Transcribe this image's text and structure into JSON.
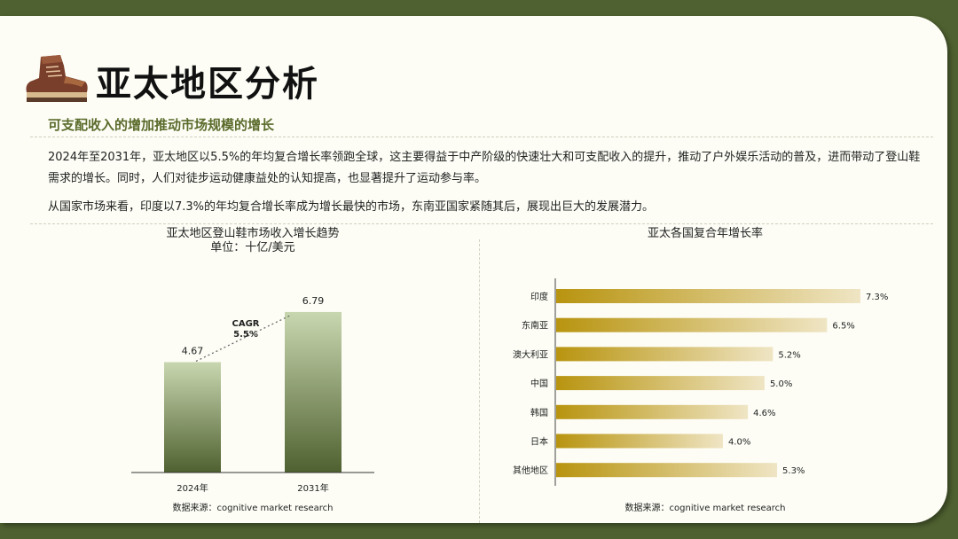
{
  "page": {
    "title": "亚太地区分析",
    "subtitle": "可支配收入的增加推动市场规模的增长",
    "paragraph1": "2024年至2031年，亚太地区以5.5%的年均复合增长率领跑全球，这主要得益于中产阶级的快速壮大和可支配收入的提升，推动了户外娱乐活动的普及，进而带动了登山鞋需求的增长。同时，人们对徒步运动健康益处的认知提高，也显著提升了运动参与率。",
    "paragraph2": "从国家市场来看，印度以7.3%的年均复合增长率成为增长最快的市场，东南亚国家紧随其后，展现出巨大的发展潜力。",
    "icon": "hiking-boot-icon"
  },
  "colors": {
    "frame": "#4f6130",
    "card": "#fdfdf6",
    "accent_text": "#5a6b2b",
    "bar_top": "#c9d7b0",
    "bar_bottom": "#4f6130",
    "hbar_dark": "#b8940f",
    "hbar_light": "#efe5c4"
  },
  "chart_data": [
    {
      "type": "bar",
      "title": "亚太地区登山鞋市场收入增长趋势",
      "subtitle": "单位：十亿/美元",
      "categories": [
        "2024年",
        "2031年"
      ],
      "values": [
        4.67,
        6.79
      ],
      "value_labels": [
        "4.67",
        "6.79"
      ],
      "annotation": {
        "label": "CAGR",
        "value": "5.5%"
      },
      "ylim": [
        0,
        7.5
      ],
      "source": "数据来源：cognitive market research"
    },
    {
      "type": "bar",
      "orientation": "horizontal",
      "title": "亚太各国复合年增长率",
      "categories": [
        "印度",
        "东南亚",
        "澳大利亚",
        "中国",
        "韩国",
        "日本",
        "其他地区"
      ],
      "values": [
        7.3,
        6.5,
        5.2,
        5.0,
        4.6,
        4.0,
        5.3
      ],
      "value_labels": [
        "7.3%",
        "6.5%",
        "5.2%",
        "5.0%",
        "4.6%",
        "4.0%",
        "5.3%"
      ],
      "xlim": [
        0,
        8.3
      ],
      "source": "数据来源：cognitive market research"
    }
  ]
}
